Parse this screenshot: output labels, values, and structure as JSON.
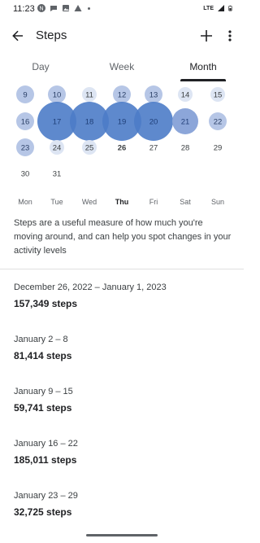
{
  "status_bar": {
    "time": "11:23",
    "network": "LTE"
  },
  "app_bar": {
    "title": "Steps"
  },
  "tabs": [
    {
      "label": "Day",
      "active": false
    },
    {
      "label": "Week",
      "active": false
    },
    {
      "label": "Month",
      "active": true
    }
  ],
  "calendar": {
    "rows": [
      {
        "days": [
          {
            "day": "9",
            "level": "light"
          },
          {
            "day": "10",
            "level": "light"
          },
          {
            "day": "11",
            "level": "faint"
          },
          {
            "day": "12",
            "level": "light"
          },
          {
            "day": "13",
            "level": "light"
          },
          {
            "day": "14",
            "level": "faint"
          },
          {
            "day": "15",
            "level": "faint"
          }
        ]
      },
      {
        "days": [
          {
            "day": "16",
            "level": "light"
          },
          {
            "day": "17",
            "level": "large"
          },
          {
            "day": "18",
            "level": "large"
          },
          {
            "day": "19",
            "level": "large"
          },
          {
            "day": "20",
            "level": "large"
          },
          {
            "day": "21",
            "level": "medium"
          },
          {
            "day": "22",
            "level": "light"
          }
        ]
      },
      {
        "days": [
          {
            "day": "23",
            "level": "light"
          },
          {
            "day": "24",
            "level": "faint"
          },
          {
            "day": "25",
            "level": "faint"
          },
          {
            "day": "26",
            "level": "none",
            "today": true
          },
          {
            "day": "27",
            "level": "none"
          },
          {
            "day": "28",
            "level": "none"
          },
          {
            "day": "29",
            "level": "none"
          }
        ]
      },
      {
        "days": [
          {
            "day": "30",
            "level": "none"
          },
          {
            "day": "31",
            "level": "none"
          }
        ]
      }
    ],
    "weekdays": [
      "Mon",
      "Tue",
      "Wed",
      "Thu",
      "Fri",
      "Sat",
      "Sun"
    ],
    "today_weekday": "Thu"
  },
  "description": "Steps are a useful measure of how much you're moving around, and can help you spot changes in your activity levels",
  "weeks": [
    {
      "range": "December 26, 2022 – January 1, 2023",
      "steps": "157,349 steps"
    },
    {
      "range": "January 2 – 8",
      "steps": "81,414 steps"
    },
    {
      "range": "January 9 – 15",
      "steps": "59,741 steps"
    },
    {
      "range": "January 16 – 22",
      "steps": "185,011 steps"
    },
    {
      "range": "January 23 – 29",
      "steps": "32,725 steps"
    }
  ],
  "colors": {
    "bubble_large": "#4d7cc8",
    "bubble_medium": "#8ca6d9",
    "bubble_light": "#b6c6e6",
    "bubble_faint": "#dde5f3",
    "text_primary": "#202124",
    "text_secondary": "#5f6368"
  },
  "icons": [
    "back-arrow-icon",
    "add-icon",
    "more-vert-icon"
  ]
}
